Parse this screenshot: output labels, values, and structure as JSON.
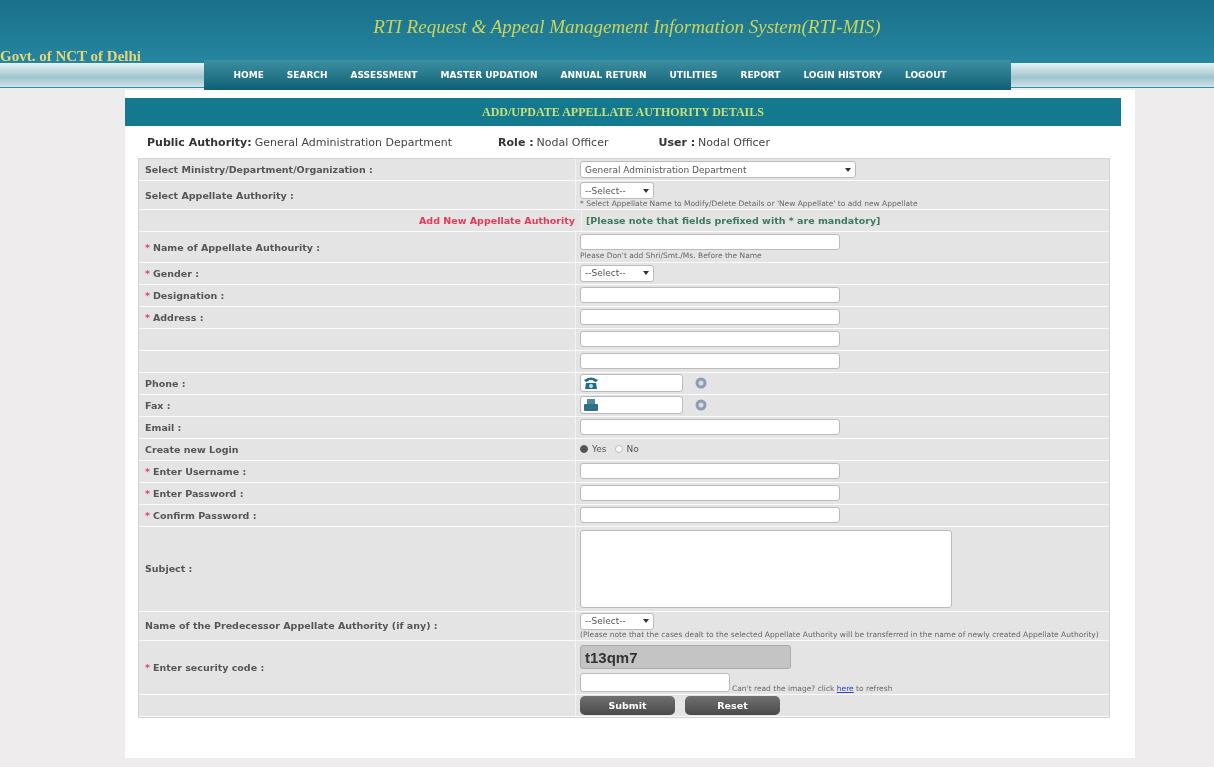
{
  "header": {
    "title": "RTI Request & Appeal Management Information System(RTI-MIS)",
    "org": "Govt. of NCT of Delhi"
  },
  "nav": [
    {
      "label": "HOME"
    },
    {
      "label": "SEARCH"
    },
    {
      "label": "ASSESSMENT"
    },
    {
      "label": "MASTER UPDATION"
    },
    {
      "label": "ANNUAL RETURN"
    },
    {
      "label": "UTILITIES"
    },
    {
      "label": "REPORT"
    },
    {
      "label": "LOGIN HISTORY"
    },
    {
      "label": "LOGOUT"
    }
  ],
  "page_title": "ADD/UPDATE APPELLATE AUTHORITY DETAILS",
  "info": [
    {
      "label": "Public Authority:",
      "value": "General Administration Department"
    },
    {
      "label": "Role :",
      "value": "Nodal Officer"
    },
    {
      "label": "User :",
      "value": "Nodal Officer"
    }
  ],
  "rows": [
    {
      "kind": "wide-select",
      "label": "Select Ministry/Department/Organization :",
      "value": "General Administration Department"
    },
    {
      "kind": "select",
      "label": "Select Appellate Authority :",
      "value": "--Select--",
      "note": "* Select Appellate Name to Modify/Delete Details or 'New Appellate' to add new Appellate"
    },
    {
      "kind": "heading",
      "title": "Add New Appellate Authority",
      "note": "[Please note that fields prefixed with * are mandatory]"
    },
    {
      "kind": "text",
      "marker": "*",
      "label": "Name of Appellate Authourity :",
      "note": "Please Don't add Shri/Smt./Ms. Before the Name"
    },
    {
      "kind": "select",
      "marker": "*",
      "label": "Gender :",
      "value": "--Select--"
    },
    {
      "kind": "text",
      "marker": "*",
      "label": "Designation :"
    },
    {
      "kind": "text",
      "marker": "*",
      "label": "Address :"
    },
    {
      "kind": "text"
    },
    {
      "kind": "text"
    },
    {
      "kind": "phone",
      "label": "Phone :"
    },
    {
      "kind": "fax",
      "label": "Fax :"
    },
    {
      "kind": "text",
      "label": "Email :"
    },
    {
      "kind": "radio",
      "label": "Create new Login",
      "options": [
        {
          "label": "Yes",
          "selected": true
        },
        {
          "label": "No",
          "selected": false
        }
      ]
    },
    {
      "kind": "text",
      "marker": "*",
      "label": "Enter Username  :"
    },
    {
      "kind": "text",
      "marker": "*",
      "label": "Enter Password  :"
    },
    {
      "kind": "text",
      "marker": "*",
      "label": "Confirm Password  :"
    },
    {
      "kind": "textarea",
      "label": "Subject :"
    },
    {
      "kind": "select",
      "label": "Name of the Predecessor Appellate Authority (if any) :",
      "value": "--Select--",
      "note": "(Please note that the cases dealt to the selected Appellate Authority will be transferred in the name of newly created Appellate Authority)"
    },
    {
      "kind": "captcha",
      "marker": "*",
      "label": "Enter security code :",
      "code": "t13qm7",
      "hint_before": "Can't read the image? click",
      "link": "here",
      "hint_after": "to refresh"
    },
    {
      "kind": "buttons",
      "buttons": [
        "Submit",
        "Reset"
      ]
    }
  ]
}
